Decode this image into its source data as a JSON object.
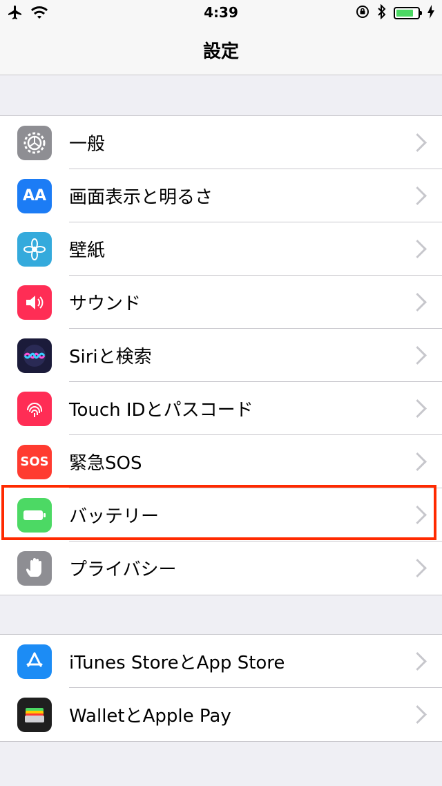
{
  "status": {
    "time": "4:39"
  },
  "nav": {
    "title": "設定"
  },
  "groups": [
    {
      "items": [
        {
          "label": "一般",
          "icon": "gear-icon",
          "color": "#8e8e93"
        },
        {
          "label": "画面表示と明るさ",
          "icon": "text-size-icon",
          "color": "#1c7cf5",
          "icon_text": "AA"
        },
        {
          "label": "壁紙",
          "icon": "flower-icon",
          "color": "#34aadc"
        },
        {
          "label": "サウンド",
          "icon": "speaker-icon",
          "color": "#ff2d55"
        },
        {
          "label": "Siriと検索",
          "icon": "siri-icon",
          "color": "#1b1b3a"
        },
        {
          "label": "Touch IDとパスコード",
          "icon": "fingerprint-icon",
          "color": "#ff2d55"
        },
        {
          "label": "緊急SOS",
          "icon": "sos-icon",
          "color": "#ff3b30",
          "icon_text": "SOS"
        },
        {
          "label": "バッテリー",
          "icon": "battery-icon",
          "color": "#4cd964"
        },
        {
          "label": "プライバシー",
          "icon": "hand-icon",
          "color": "#8e8e93"
        }
      ]
    },
    {
      "items": [
        {
          "label": "iTunes StoreとApp Store",
          "icon": "app-store-icon",
          "color": "#1c8cf5"
        },
        {
          "label": "WalletとApple Pay",
          "icon": "wallet-icon",
          "color": "#1f1f1f"
        }
      ]
    }
  ]
}
